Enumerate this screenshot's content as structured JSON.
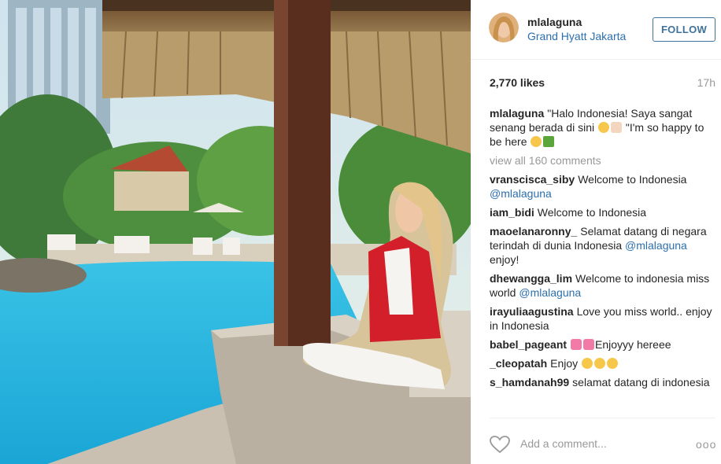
{
  "post": {
    "username": "mlalaguna",
    "location": "Grand Hyatt Jakarta",
    "follow_label": "FOLLOW",
    "likes": "2,770 likes",
    "time_ago": "17h",
    "view_all": "view all 160 comments",
    "add_comment_placeholder": "Add a comment...",
    "more_label": "ooo"
  },
  "caption": {
    "author": "mlalaguna",
    "text_1": "\"Halo Indonesia! Saya sangat senang berada di sini",
    "text_2": "\"I'm so happy to be here"
  },
  "comments": [
    {
      "author": "vranscisca_siby",
      "text": "Welcome to Indonesia",
      "mention": "@mlalaguna"
    },
    {
      "author": "iam_bidi",
      "text": "Welcome to Indonesia"
    },
    {
      "author": "maoelanaronny_",
      "text": "Selamat datang di negara terindah di dunia Indonesia",
      "mention": "@mlalaguna",
      "after": "enjoy!"
    },
    {
      "author": "dhewangga_lim",
      "text": "Welcome to indonesia miss world",
      "mention": "@mlalaguna"
    },
    {
      "author": "irayuliaagustina",
      "text": "Love you miss world.. enjoy in Indonesia"
    },
    {
      "author": "babel_pageant",
      "text": "Enjoyyy hereee"
    },
    {
      "author": "_cleopatah",
      "text": "Enjoy"
    },
    {
      "author": "s_hamdanah99",
      "text": "selamat datang di indonesia"
    }
  ],
  "icons": {
    "heart": "heart-icon",
    "more": "more-options-icon",
    "emoji": "emoji-icon"
  },
  "colors": {
    "link": "#2b6fad",
    "follow_border": "#3f729b",
    "muted": "#999999"
  }
}
